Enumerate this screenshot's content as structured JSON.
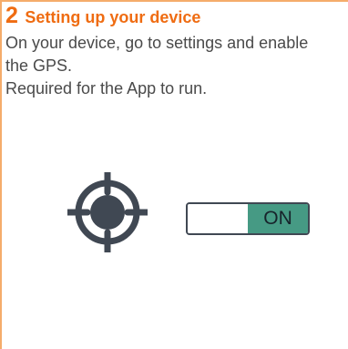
{
  "step": {
    "number": "2",
    "title": "Setting up your device"
  },
  "instructions": {
    "line1": "On your device, go to settings and enable the GPS.",
    "line2": "Required for the App to run."
  },
  "icons": {
    "location": "gps-crosshair-icon"
  },
  "toggle": {
    "state": "on",
    "on_label": "ON"
  },
  "colors": {
    "accent": "#ef6c12",
    "border": "#f5ac6b",
    "body_text": "#4a4a4a",
    "icon": "#404853",
    "toggle_on": "#469a84"
  }
}
